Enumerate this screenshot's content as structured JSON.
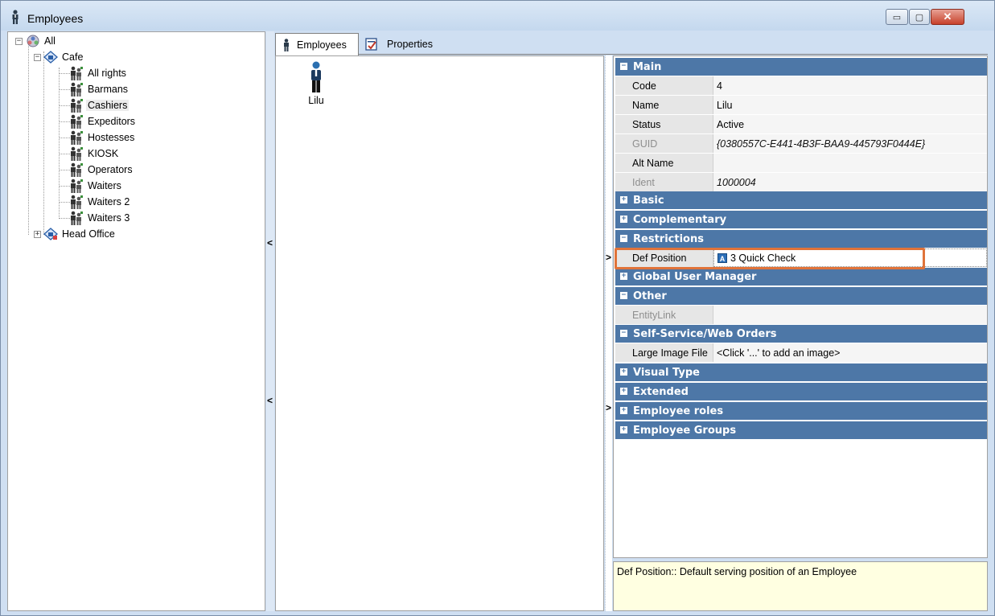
{
  "window": {
    "title": "Employees",
    "controls": {
      "minimize": "▭",
      "maximize": "▢",
      "close": "✕"
    }
  },
  "tree": {
    "root": "All",
    "cafe": "Cafe",
    "groups": [
      "All rights",
      "Barmans",
      "Cashiers",
      "Expeditors",
      "Hostesses",
      "KIOSK",
      "Operators",
      "Waiters",
      "Waiters 2",
      "Waiters 3"
    ],
    "selected_group": "Cashiers",
    "head_office": "Head Office"
  },
  "tabs": {
    "employees": "Employees",
    "properties": "Properties"
  },
  "employee_list": {
    "items": [
      {
        "name": "Lilu",
        "icon": "person-icon"
      }
    ]
  },
  "property_grid": {
    "main": {
      "label": "Main",
      "code": {
        "name": "Code",
        "value": "4"
      },
      "name": {
        "name": "Name",
        "value": "Lilu"
      },
      "status": {
        "name": "Status",
        "value": "Active"
      },
      "guid": {
        "name": "GUID",
        "value": "{0380557C-E441-4B3F-BAA9-445793F0444E}"
      },
      "alt_name": {
        "name": "Alt Name",
        "value": ""
      },
      "ident": {
        "name": "Ident",
        "value": "1000004"
      }
    },
    "basic": "Basic",
    "complementary": "Complementary",
    "restrictions": {
      "label": "Restrictions",
      "def_position": {
        "name": "Def Position",
        "value": "3 Quick Check"
      }
    },
    "global_user_manager": "Global User Manager",
    "other": {
      "label": "Other",
      "entity_link": {
        "name": "EntityLink",
        "value": ""
      }
    },
    "self_service": {
      "label": "Self-Service/Web Orders",
      "large_image": {
        "name": "Large Image File",
        "value": "<Click '...' to add an image>"
      }
    },
    "visual_type": "Visual Type",
    "extended": "Extended",
    "employee_roles": "Employee roles",
    "employee_groups": "Employee Groups"
  },
  "description": "Def Position:: Default serving position of an Employee",
  "colors": {
    "category_header": "#4d77a7",
    "highlight": "#e0733a",
    "description_bg": "#ffffe1"
  }
}
